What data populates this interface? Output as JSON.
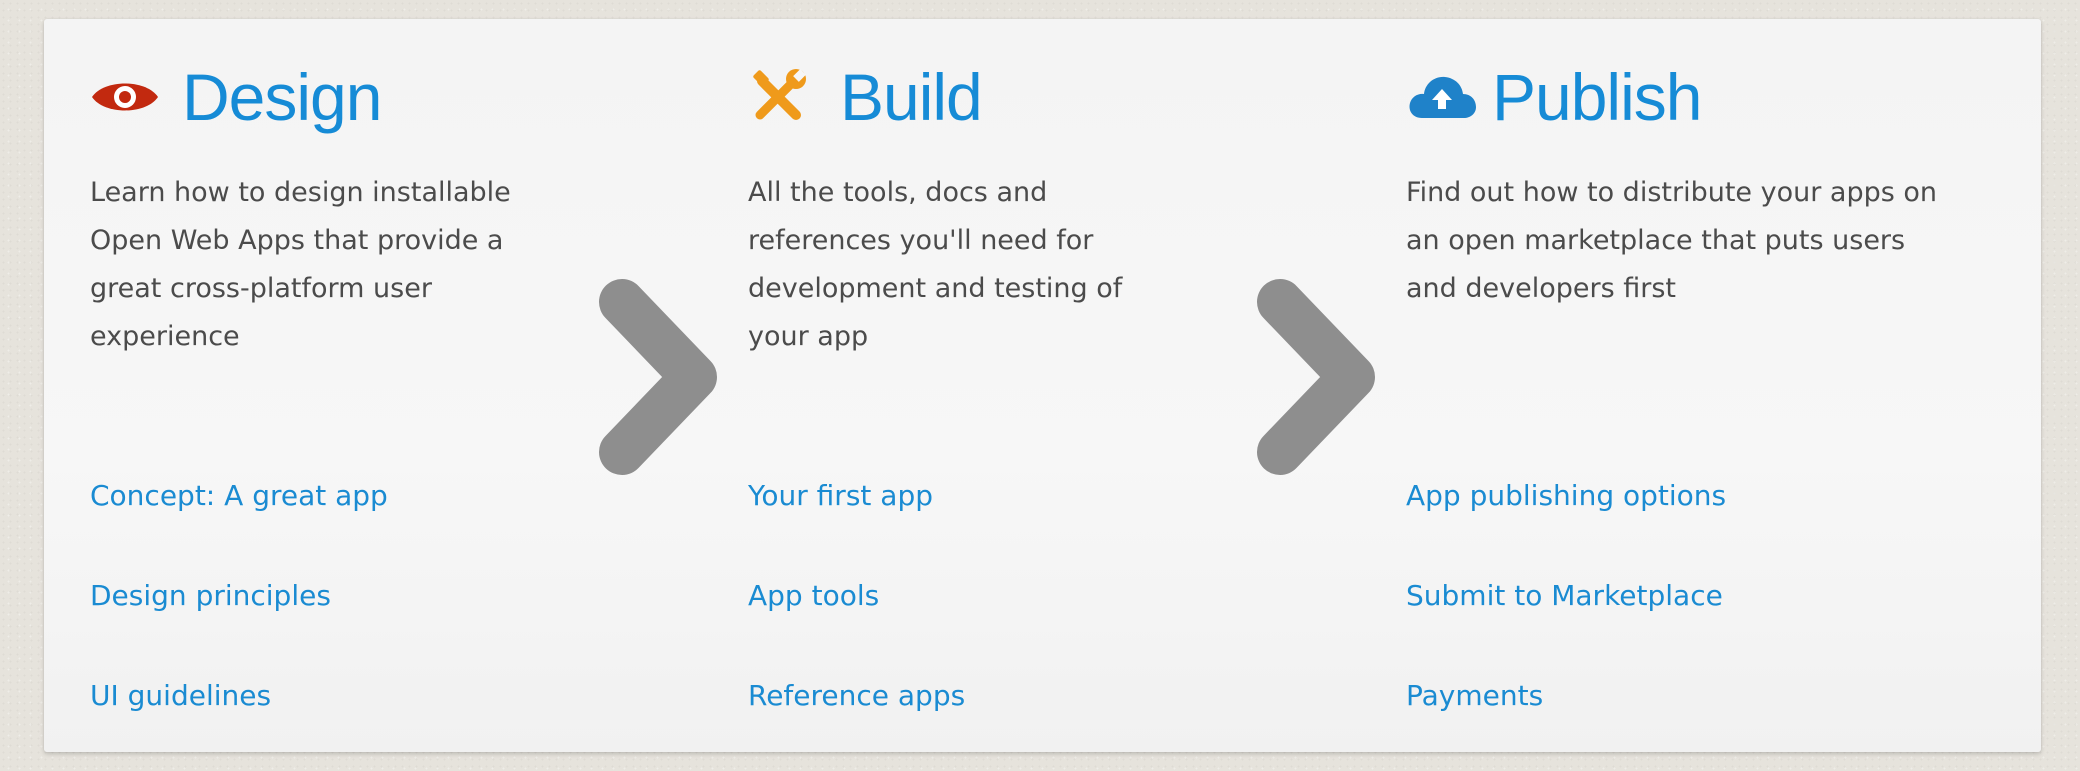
{
  "colors": {
    "heading_blue": "#168bd6",
    "link_blue": "#1a8bd2",
    "design_icon_red": "#c2290f",
    "build_icon_orange": "#ef9a1b",
    "publish_icon_blue": "#1f82c9",
    "chevron_gray": "#8e8e8e",
    "text_gray": "#4b4b4b"
  },
  "sections": {
    "design": {
      "icon": "eye-icon",
      "title": "Design",
      "desc_lines": [
        "Learn how to design installable",
        "Open Web Apps that provide a",
        "great cross-platform user",
        "experience"
      ],
      "links": [
        "Concept: A great app",
        "Design principles",
        "UI guidelines"
      ]
    },
    "build": {
      "icon": "wrench-screwdriver-icon",
      "title": "Build",
      "desc_lines": [
        "All the tools, docs and",
        "references you'll need for",
        "development and testing of",
        "your app"
      ],
      "links": [
        "Your first app",
        "App tools",
        "Reference apps"
      ]
    },
    "publish": {
      "icon": "cloud-upload-icon",
      "title": "Publish",
      "desc_lines": [
        "Find out how to distribute your apps on",
        "an open marketplace that puts users",
        "and developers first"
      ],
      "links": [
        "App publishing options",
        "Submit to Marketplace",
        "Payments"
      ]
    }
  },
  "separators": [
    "chevron-right-icon",
    "chevron-right-icon"
  ]
}
